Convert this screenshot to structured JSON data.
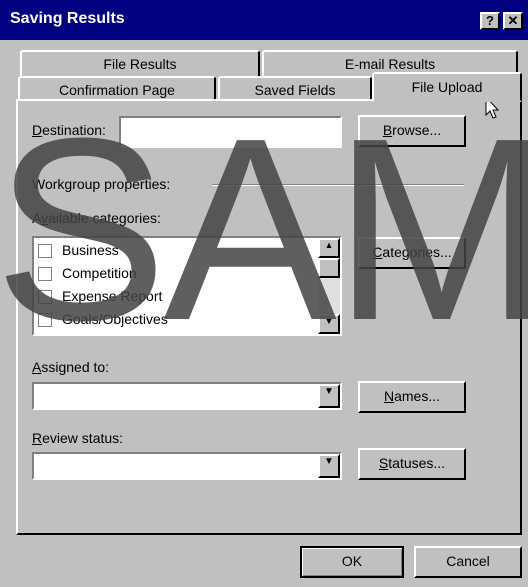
{
  "window": {
    "title": "Saving Results",
    "help_glyph": "?",
    "close_glyph": "✕"
  },
  "tabs": {
    "row1": [
      "File Results",
      "E-mail Results"
    ],
    "row2": [
      "Confirmation Page",
      "Saved Fields",
      "File Upload"
    ],
    "active": "File Upload"
  },
  "destination": {
    "label_pre": "",
    "label_acc": "D",
    "label_post": "estination:",
    "value": "",
    "browse_acc": "B",
    "browse_post": "rowse..."
  },
  "workgroup": {
    "heading": "Workgroup properties:",
    "available_label_pre": "A",
    "available_label_acc": "v",
    "available_label_post": "ailable categories:",
    "categories": [
      "Business",
      "Competition",
      "Expense Report",
      "Goals/Objectives"
    ],
    "categories_btn_acc": "C",
    "categories_btn_post": "ategories..."
  },
  "assigned": {
    "label_acc": "A",
    "label_post": "ssigned to:",
    "value": "",
    "btn_acc": "N",
    "btn_post": "ames..."
  },
  "review": {
    "label_acc": "R",
    "label_post": "eview status:",
    "value": "",
    "btn_acc": "S",
    "btn_post": "tatuses..."
  },
  "footer": {
    "ok": "OK",
    "cancel": "Cancel"
  },
  "watermark": "SAM"
}
